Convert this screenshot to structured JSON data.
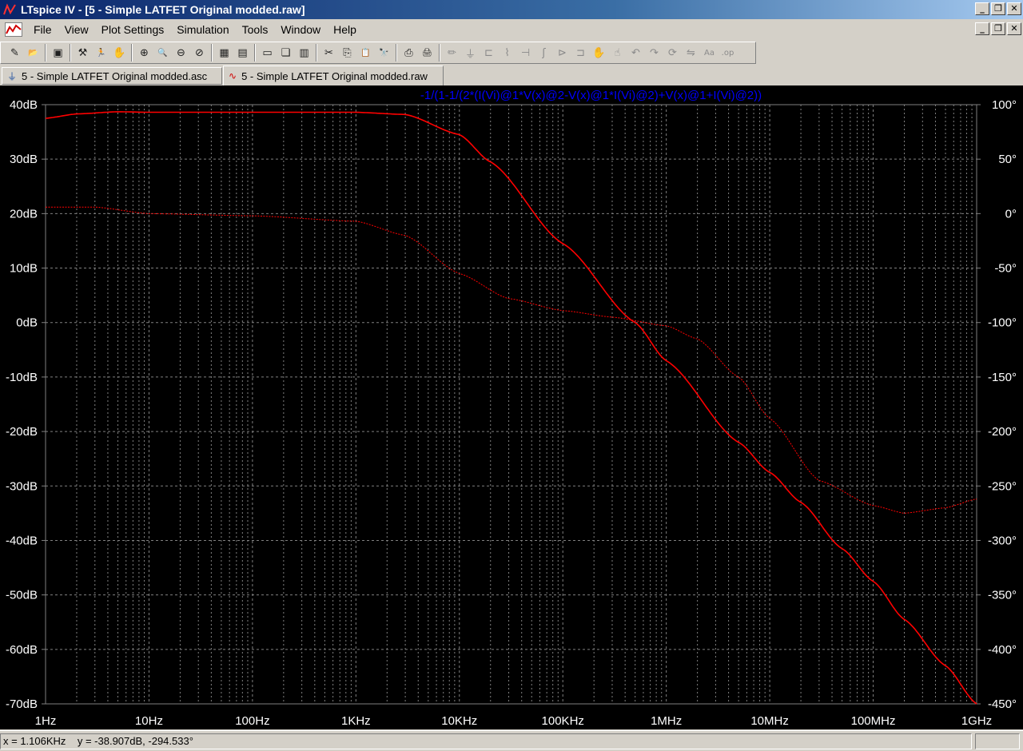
{
  "window": {
    "title": "LTspice IV - [5 - Simple LATFET Original modded.raw]",
    "min": "_",
    "restore": "❐",
    "close": "✕"
  },
  "menu": {
    "items": [
      "File",
      "View",
      "Plot Settings",
      "Simulation",
      "Tools",
      "Window",
      "Help"
    ]
  },
  "toolbar": {
    "icons": [
      {
        "name": "new-schematic-icon",
        "glyph": "✎"
      },
      {
        "name": "open-icon",
        "glyph": "📂"
      },
      {
        "sep": true
      },
      {
        "name": "save-icon",
        "glyph": "▣"
      },
      {
        "sep": true
      },
      {
        "name": "control-panel-icon",
        "glyph": "⚒"
      },
      {
        "name": "run-icon",
        "glyph": "🏃"
      },
      {
        "name": "halt-icon",
        "glyph": "✋"
      },
      {
        "sep": true
      },
      {
        "name": "zoom-area-icon",
        "glyph": "⊕"
      },
      {
        "name": "zoom-in-icon",
        "glyph": "🔍"
      },
      {
        "name": "zoom-out-icon",
        "glyph": "⊖"
      },
      {
        "name": "zoom-cancel-icon",
        "glyph": "⊘"
      },
      {
        "sep": true
      },
      {
        "name": "autorange-icon",
        "glyph": "▦"
      },
      {
        "name": "pick-visible-traces-icon",
        "glyph": "▤"
      },
      {
        "sep": true
      },
      {
        "name": "tile-horizontal-icon",
        "glyph": "▭"
      },
      {
        "name": "cascade-icon",
        "glyph": "❏"
      },
      {
        "name": "tile-vertical-icon",
        "glyph": "▥"
      },
      {
        "sep": true
      },
      {
        "name": "cut-icon",
        "glyph": "✂"
      },
      {
        "name": "copy-icon",
        "glyph": "⎘"
      },
      {
        "name": "paste-icon",
        "glyph": "📋"
      },
      {
        "name": "find-icon",
        "glyph": "🔭"
      },
      {
        "sep": true
      },
      {
        "name": "print-preview-icon",
        "glyph": "⎙"
      },
      {
        "name": "print-icon",
        "glyph": "🖨"
      },
      {
        "sep": true
      },
      {
        "name": "draw-wire-icon",
        "glyph": "✏",
        "dim": true
      },
      {
        "name": "ground-icon",
        "glyph": "⏚",
        "dim": true
      },
      {
        "name": "label-net-icon",
        "glyph": "⊏",
        "dim": true
      },
      {
        "name": "resistor-icon",
        "glyph": "⌇",
        "dim": true
      },
      {
        "name": "capacitor-icon",
        "glyph": "⊣",
        "dim": true
      },
      {
        "name": "inductor-icon",
        "glyph": "ʃ",
        "dim": true
      },
      {
        "name": "diode-icon",
        "glyph": "⊳",
        "dim": true
      },
      {
        "name": "component-icon",
        "glyph": "⊐",
        "dim": true
      },
      {
        "name": "move-icon",
        "glyph": "✋",
        "dim": true
      },
      {
        "name": "drag-icon",
        "glyph": "☝",
        "dim": true
      },
      {
        "name": "undo-icon",
        "glyph": "↶",
        "dim": true
      },
      {
        "name": "redo-icon",
        "glyph": "↷",
        "dim": true
      },
      {
        "name": "rotate-icon",
        "glyph": "⟳",
        "dim": true
      },
      {
        "name": "mirror-icon",
        "glyph": "⇋",
        "dim": true
      },
      {
        "name": "text-icon",
        "glyph": "Aa",
        "dim": true
      },
      {
        "name": "spice-directive-icon",
        "glyph": ".op",
        "dim": true
      }
    ]
  },
  "tabs": [
    {
      "label": "5 - Simple LATFET Original modded.asc",
      "icon": "schematic-icon",
      "glyph": "⏚",
      "active": false
    },
    {
      "label": "5 - Simple LATFET Original modded.raw",
      "icon": "waveform-icon",
      "glyph": "∿",
      "active": true
    }
  ],
  "plot": {
    "background": "#000000",
    "grid_color": "#808080",
    "trace_color": "#ff0000",
    "expression_color": "#0000ff",
    "axis_text_color": "#ffffff"
  },
  "chart_data": {
    "type": "line",
    "title": "-1/(1-1/(2*(I(Vi)@1*V(x)@2-V(x)@1*I(Vi)@2)+V(x)@1+I(Vi)@2))",
    "xscale": "log",
    "xlim": [
      1,
      1000000000
    ],
    "xticks": [
      {
        "v": 1,
        "label": "1Hz"
      },
      {
        "v": 10,
        "label": "10Hz"
      },
      {
        "v": 100,
        "label": "100Hz"
      },
      {
        "v": 1000,
        "label": "1KHz"
      },
      {
        "v": 10000,
        "label": "10KHz"
      },
      {
        "v": 100000,
        "label": "100KHz"
      },
      {
        "v": 1000000,
        "label": "1MHz"
      },
      {
        "v": 10000000,
        "label": "10MHz"
      },
      {
        "v": 100000000,
        "label": "100MHz"
      },
      {
        "v": 1000000000,
        "label": "1GHz"
      }
    ],
    "ylim": [
      -70,
      40
    ],
    "yticks": [
      {
        "v": 40,
        "label": "40dB"
      },
      {
        "v": 30,
        "label": "30dB"
      },
      {
        "v": 20,
        "label": "20dB"
      },
      {
        "v": 10,
        "label": "10dB"
      },
      {
        "v": 0,
        "label": "0dB"
      },
      {
        "v": -10,
        "label": "-10dB"
      },
      {
        "v": -20,
        "label": "-20dB"
      },
      {
        "v": -30,
        "label": "-30dB"
      },
      {
        "v": -40,
        "label": "-40dB"
      },
      {
        "v": -50,
        "label": "-50dB"
      },
      {
        "v": -60,
        "label": "-60dB"
      },
      {
        "v": -70,
        "label": "-70dB"
      }
    ],
    "y2lim": [
      -450,
      100
    ],
    "y2ticks": [
      {
        "v": 100,
        "label": "100°"
      },
      {
        "v": 50,
        "label": "50°"
      },
      {
        "v": 0,
        "label": "0°"
      },
      {
        "v": -50,
        "label": "-50°"
      },
      {
        "v": -100,
        "label": "-100°"
      },
      {
        "v": -150,
        "label": "-150°"
      },
      {
        "v": -200,
        "label": "-200°"
      },
      {
        "v": -250,
        "label": "-250°"
      },
      {
        "v": -300,
        "label": "-300°"
      },
      {
        "v": -350,
        "label": "-350°"
      },
      {
        "v": -400,
        "label": "-400°"
      },
      {
        "v": -450,
        "label": "-450°"
      }
    ],
    "grid": true,
    "series": [
      {
        "kind": "magnitude",
        "axis": "left",
        "style": "solid",
        "x": [
          1,
          2,
          5,
          10,
          100,
          1000,
          3000,
          10000,
          20000,
          100000,
          500000,
          1000000,
          5000000,
          10000000,
          20000000,
          50000000,
          100000000,
          200000000,
          500000000,
          1000000000
        ],
        "y": [
          37.5,
          38.3,
          38.7,
          38.6,
          38.6,
          38.6,
          38.2,
          34.5,
          29.5,
          14.5,
          0,
          -7,
          -22,
          -27.5,
          -33,
          -41.5,
          -47.5,
          -54.5,
          -63,
          -70
        ]
      },
      {
        "kind": "phase",
        "axis": "right",
        "style": "dotted",
        "x": [
          1,
          3,
          10,
          100,
          1000,
          3000,
          10000,
          30000,
          100000,
          300000,
          1000000,
          2000000,
          5000000,
          10000000,
          30000000,
          100000000,
          200000000,
          500000000,
          1000000000
        ],
        "y": [
          6,
          6,
          0,
          -2,
          -7,
          -20,
          -55,
          -78,
          -89,
          -95,
          -103,
          -115,
          -150,
          -188,
          -245,
          -268,
          -275,
          -270,
          -262
        ]
      }
    ]
  },
  "status": {
    "cursor": "x = 1.106KHz    y = -38.907dB, -294.533°"
  }
}
